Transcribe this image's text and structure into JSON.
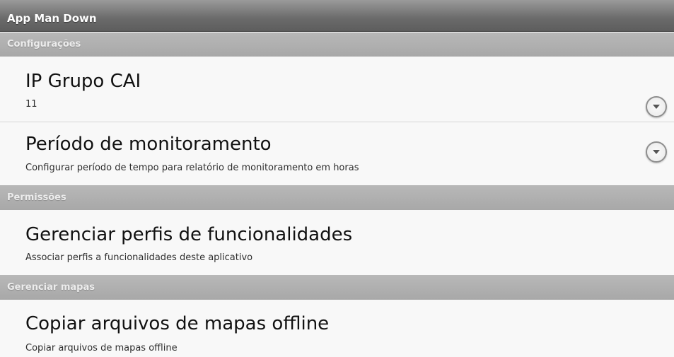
{
  "app": {
    "title": "App Man Down"
  },
  "sections": {
    "configuracoes": {
      "label": "Configurações"
    },
    "permissoes": {
      "label": "Permissões"
    },
    "mapas": {
      "label": "Gerenciar mapas"
    }
  },
  "prefs": {
    "ip_grupo": {
      "title": "IP Grupo CAI",
      "summary": "11",
      "icon": "dropdown-arrow-icon"
    },
    "periodo": {
      "title": "Período de monitoramento",
      "summary": "Configurar período de tempo para relatório de monitoramento em horas",
      "icon": "dropdown-arrow-icon"
    },
    "perfis": {
      "title": "Gerenciar perfis de funcionalidades",
      "summary": "Associar perfis a funcionalidades deste aplicativo"
    },
    "copiar": {
      "title": "Copiar arquivos de mapas offline",
      "summary": "Copiar arquivos de mapas offline"
    }
  }
}
